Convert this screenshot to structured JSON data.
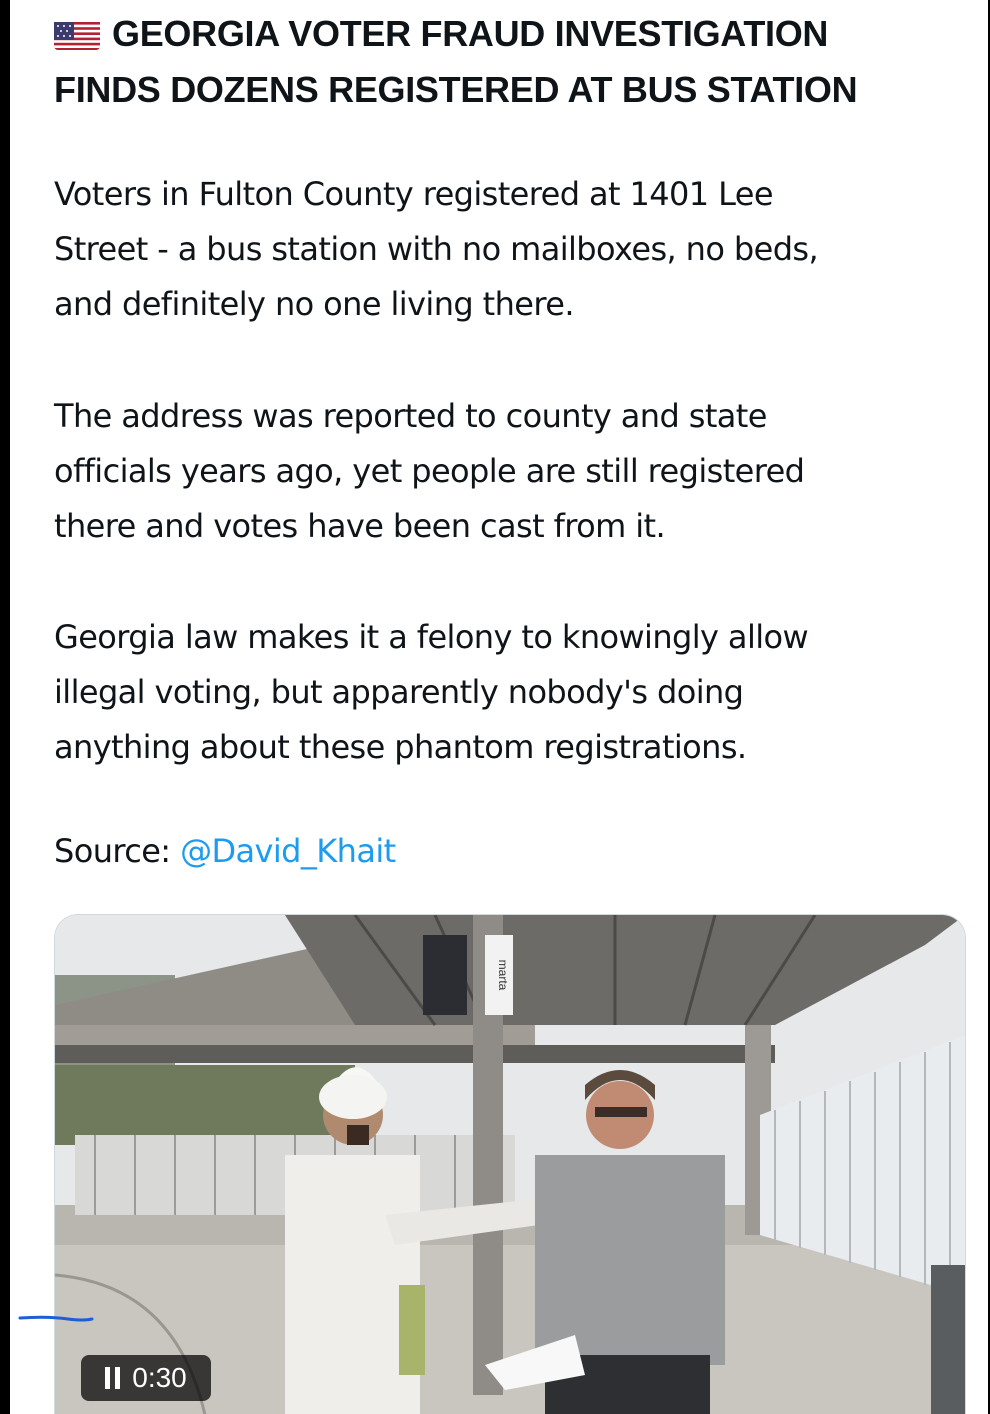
{
  "post": {
    "headline_line1": "GEORGIA VOTER FRAUD INVESTIGATION",
    "headline_line2": "FINDS DOZENS REGISTERED AT BUS STATION",
    "flag_icon": "us-flag-icon",
    "paragraphs": [
      [
        "Voters in Fulton County registered at 1401 Lee",
        "Street - a bus station with no mailboxes, no beds,",
        "and definitely no one living there."
      ],
      [
        "The address was reported to county and state",
        "officials years ago, yet people are still registered",
        "there and votes have been cast from it."
      ],
      [
        "Georgia law makes it a felony to knowingly allow",
        "illegal voting, but apparently nobody's doing",
        "anything about these phantom registrations."
      ]
    ],
    "source_label": "Source:",
    "source_handle": "@David_Khait"
  },
  "video": {
    "timestamp": "0:30",
    "state": "playing",
    "sign_text": "marta"
  },
  "colors": {
    "text": "#0f1419",
    "link": "#1d9bf0",
    "scribble": "#1f5fd6"
  }
}
